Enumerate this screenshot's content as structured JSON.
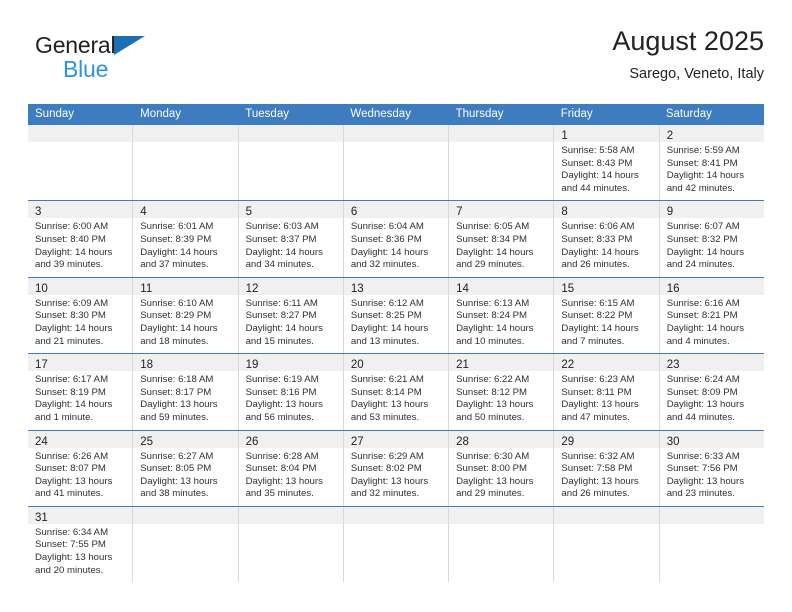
{
  "brand": {
    "word_general": "General",
    "word_blue": "Blue",
    "flag_icon": "blue-triangle-flag-icon",
    "accent_blue": "#1a6fb5",
    "light_blue": "#2f93e0"
  },
  "header": {
    "title": "August 2025",
    "subtitle": "Sarego, Veneto, Italy"
  },
  "calendar": {
    "header_bg": "#3c7cbf",
    "daynum_bg": "#f0f0f0",
    "weekdays": [
      "Sunday",
      "Monday",
      "Tuesday",
      "Wednesday",
      "Thursday",
      "Friday",
      "Saturday"
    ],
    "weeks": [
      [
        {
          "day": "",
          "empty": true,
          "lines": []
        },
        {
          "day": "",
          "empty": true,
          "lines": []
        },
        {
          "day": "",
          "empty": true,
          "lines": []
        },
        {
          "day": "",
          "empty": true,
          "lines": []
        },
        {
          "day": "",
          "empty": true,
          "lines": []
        },
        {
          "day": "1",
          "empty": false,
          "lines": [
            "Sunrise: 5:58 AM",
            "Sunset: 8:43 PM",
            "Daylight: 14 hours",
            "and 44 minutes."
          ]
        },
        {
          "day": "2",
          "empty": false,
          "lines": [
            "Sunrise: 5:59 AM",
            "Sunset: 8:41 PM",
            "Daylight: 14 hours",
            "and 42 minutes."
          ]
        }
      ],
      [
        {
          "day": "3",
          "empty": false,
          "lines": [
            "Sunrise: 6:00 AM",
            "Sunset: 8:40 PM",
            "Daylight: 14 hours",
            "and 39 minutes."
          ]
        },
        {
          "day": "4",
          "empty": false,
          "lines": [
            "Sunrise: 6:01 AM",
            "Sunset: 8:39 PM",
            "Daylight: 14 hours",
            "and 37 minutes."
          ]
        },
        {
          "day": "5",
          "empty": false,
          "lines": [
            "Sunrise: 6:03 AM",
            "Sunset: 8:37 PM",
            "Daylight: 14 hours",
            "and 34 minutes."
          ]
        },
        {
          "day": "6",
          "empty": false,
          "lines": [
            "Sunrise: 6:04 AM",
            "Sunset: 8:36 PM",
            "Daylight: 14 hours",
            "and 32 minutes."
          ]
        },
        {
          "day": "7",
          "empty": false,
          "lines": [
            "Sunrise: 6:05 AM",
            "Sunset: 8:34 PM",
            "Daylight: 14 hours",
            "and 29 minutes."
          ]
        },
        {
          "day": "8",
          "empty": false,
          "lines": [
            "Sunrise: 6:06 AM",
            "Sunset: 8:33 PM",
            "Daylight: 14 hours",
            "and 26 minutes."
          ]
        },
        {
          "day": "9",
          "empty": false,
          "lines": [
            "Sunrise: 6:07 AM",
            "Sunset: 8:32 PM",
            "Daylight: 14 hours",
            "and 24 minutes."
          ]
        }
      ],
      [
        {
          "day": "10",
          "empty": false,
          "lines": [
            "Sunrise: 6:09 AM",
            "Sunset: 8:30 PM",
            "Daylight: 14 hours",
            "and 21 minutes."
          ]
        },
        {
          "day": "11",
          "empty": false,
          "lines": [
            "Sunrise: 6:10 AM",
            "Sunset: 8:29 PM",
            "Daylight: 14 hours",
            "and 18 minutes."
          ]
        },
        {
          "day": "12",
          "empty": false,
          "lines": [
            "Sunrise: 6:11 AM",
            "Sunset: 8:27 PM",
            "Daylight: 14 hours",
            "and 15 minutes."
          ]
        },
        {
          "day": "13",
          "empty": false,
          "lines": [
            "Sunrise: 6:12 AM",
            "Sunset: 8:25 PM",
            "Daylight: 14 hours",
            "and 13 minutes."
          ]
        },
        {
          "day": "14",
          "empty": false,
          "lines": [
            "Sunrise: 6:13 AM",
            "Sunset: 8:24 PM",
            "Daylight: 14 hours",
            "and 10 minutes."
          ]
        },
        {
          "day": "15",
          "empty": false,
          "lines": [
            "Sunrise: 6:15 AM",
            "Sunset: 8:22 PM",
            "Daylight: 14 hours",
            "and 7 minutes."
          ]
        },
        {
          "day": "16",
          "empty": false,
          "lines": [
            "Sunrise: 6:16 AM",
            "Sunset: 8:21 PM",
            "Daylight: 14 hours",
            "and 4 minutes."
          ]
        }
      ],
      [
        {
          "day": "17",
          "empty": false,
          "lines": [
            "Sunrise: 6:17 AM",
            "Sunset: 8:19 PM",
            "Daylight: 14 hours",
            "and 1 minute."
          ]
        },
        {
          "day": "18",
          "empty": false,
          "lines": [
            "Sunrise: 6:18 AM",
            "Sunset: 8:17 PM",
            "Daylight: 13 hours",
            "and 59 minutes."
          ]
        },
        {
          "day": "19",
          "empty": false,
          "lines": [
            "Sunrise: 6:19 AM",
            "Sunset: 8:16 PM",
            "Daylight: 13 hours",
            "and 56 minutes."
          ]
        },
        {
          "day": "20",
          "empty": false,
          "lines": [
            "Sunrise: 6:21 AM",
            "Sunset: 8:14 PM",
            "Daylight: 13 hours",
            "and 53 minutes."
          ]
        },
        {
          "day": "21",
          "empty": false,
          "lines": [
            "Sunrise: 6:22 AM",
            "Sunset: 8:12 PM",
            "Daylight: 13 hours",
            "and 50 minutes."
          ]
        },
        {
          "day": "22",
          "empty": false,
          "lines": [
            "Sunrise: 6:23 AM",
            "Sunset: 8:11 PM",
            "Daylight: 13 hours",
            "and 47 minutes."
          ]
        },
        {
          "day": "23",
          "empty": false,
          "lines": [
            "Sunrise: 6:24 AM",
            "Sunset: 8:09 PM",
            "Daylight: 13 hours",
            "and 44 minutes."
          ]
        }
      ],
      [
        {
          "day": "24",
          "empty": false,
          "lines": [
            "Sunrise: 6:26 AM",
            "Sunset: 8:07 PM",
            "Daylight: 13 hours",
            "and 41 minutes."
          ]
        },
        {
          "day": "25",
          "empty": false,
          "lines": [
            "Sunrise: 6:27 AM",
            "Sunset: 8:05 PM",
            "Daylight: 13 hours",
            "and 38 minutes."
          ]
        },
        {
          "day": "26",
          "empty": false,
          "lines": [
            "Sunrise: 6:28 AM",
            "Sunset: 8:04 PM",
            "Daylight: 13 hours",
            "and 35 minutes."
          ]
        },
        {
          "day": "27",
          "empty": false,
          "lines": [
            "Sunrise: 6:29 AM",
            "Sunset: 8:02 PM",
            "Daylight: 13 hours",
            "and 32 minutes."
          ]
        },
        {
          "day": "28",
          "empty": false,
          "lines": [
            "Sunrise: 6:30 AM",
            "Sunset: 8:00 PM",
            "Daylight: 13 hours",
            "and 29 minutes."
          ]
        },
        {
          "day": "29",
          "empty": false,
          "lines": [
            "Sunrise: 6:32 AM",
            "Sunset: 7:58 PM",
            "Daylight: 13 hours",
            "and 26 minutes."
          ]
        },
        {
          "day": "30",
          "empty": false,
          "lines": [
            "Sunrise: 6:33 AM",
            "Sunset: 7:56 PM",
            "Daylight: 13 hours",
            "and 23 minutes."
          ]
        }
      ],
      [
        {
          "day": "31",
          "empty": false,
          "lines": [
            "Sunrise: 6:34 AM",
            "Sunset: 7:55 PM",
            "Daylight: 13 hours",
            "and 20 minutes."
          ]
        },
        {
          "day": "",
          "empty": true,
          "lines": []
        },
        {
          "day": "",
          "empty": true,
          "lines": []
        },
        {
          "day": "",
          "empty": true,
          "lines": []
        },
        {
          "day": "",
          "empty": true,
          "lines": []
        },
        {
          "day": "",
          "empty": true,
          "lines": []
        },
        {
          "day": "",
          "empty": true,
          "lines": []
        }
      ]
    ]
  }
}
